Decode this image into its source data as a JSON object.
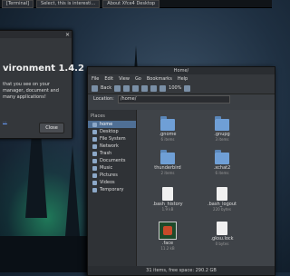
{
  "panel": {
    "tasks": [
      "[Terminal]",
      "Select, this is interesti...",
      "About Xfce4 Desktop"
    ]
  },
  "about": {
    "title": "vironment 1.4.2",
    "description": "that you see on your manager, document and many applications!",
    "link": "...",
    "close_label": "Close"
  },
  "filemanager": {
    "title": "Home/",
    "menu": [
      "File",
      "Edit",
      "View",
      "Go",
      "Bookmarks",
      "Help"
    ],
    "toolbar": {
      "back_label": "Back",
      "zoom_label": "100%"
    },
    "location_label": "Location:",
    "location_value": "/home/",
    "sidebar_head": "Places",
    "places": [
      "home",
      "Desktop",
      "File System",
      "Network",
      "Trash",
      "Documents",
      "Music",
      "Pictures",
      "Videos",
      "Temporary"
    ],
    "files": [
      {
        "name": ".gnome",
        "size": "6 items"
      },
      {
        "name": ".gnupg",
        "size": "3 items"
      },
      {
        "name": "thunderbird",
        "size": "2 items"
      },
      {
        "name": ".xchat2",
        "size": "6 items"
      },
      {
        "name": ".bash_history",
        "size": "1.9 kB"
      },
      {
        "name": ".bash_logout",
        "size": "220 bytes"
      },
      {
        "name": ".face",
        "size": "11.2 kB"
      },
      {
        "name": ".gksu.lock",
        "size": "0 bytes"
      }
    ],
    "status": "31 items, free space: 290.2 GB"
  },
  "colors": {
    "accent": "#4f6f95",
    "folder": "#6f9fd6"
  }
}
